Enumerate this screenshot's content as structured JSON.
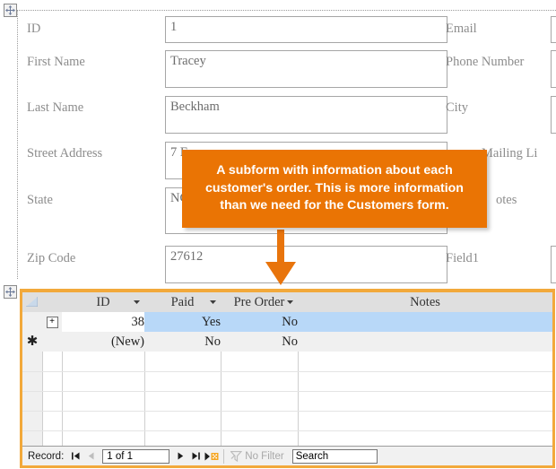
{
  "form": {
    "fields": [
      {
        "label": "ID",
        "value": "1",
        "tall": false
      },
      {
        "label": "First Name",
        "value": "Tracey",
        "tall": true
      },
      {
        "label": "Last Name",
        "value": "Beckham",
        "tall": true
      },
      {
        "label": "Street Address",
        "value": "7 E",
        "tall": true
      },
      {
        "label": "State",
        "value": "NC",
        "tall": true
      },
      {
        "label": "Zip Code",
        "value": "27612",
        "tall": true
      }
    ],
    "right_labels": [
      "Email",
      "Phone Number",
      "City",
      "Mailing Li",
      "otes",
      "Field1"
    ]
  },
  "callout": {
    "text": "A subform with information about each customer's order. This is more information than we need for the Customers form.",
    "color": "#ea7404"
  },
  "subform": {
    "border_color": "#f2a93b",
    "columns": [
      {
        "label": "ID",
        "has_dropdown": true
      },
      {
        "label": "Paid",
        "has_dropdown": true
      },
      {
        "label": "Pre Order",
        "has_dropdown": true
      },
      {
        "label": "Notes",
        "has_dropdown": false
      }
    ],
    "rows": [
      {
        "selector": "expand",
        "id": "38",
        "paid": "Yes",
        "pre_order": "No",
        "notes": "",
        "selected": true
      },
      {
        "selector": "new",
        "id": "(New)",
        "paid": "No",
        "pre_order": "No",
        "notes": "",
        "selected": false
      }
    ],
    "empty_row_count": 6
  },
  "navigator": {
    "label": "Record:",
    "first_title": "First record",
    "previous_title": "Previous record",
    "position": "1 of 1",
    "next_title": "Next record",
    "last_title": "Last record",
    "new_title": "New (blank) record",
    "filter_label": "No Filter",
    "search_value": "Search"
  }
}
